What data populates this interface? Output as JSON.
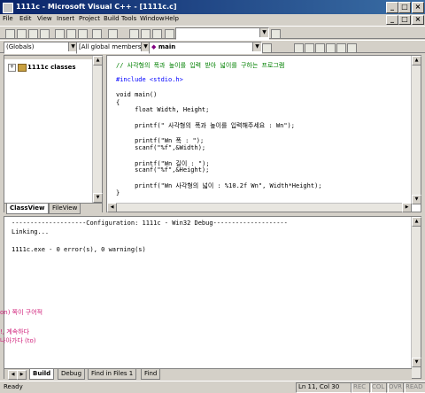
{
  "window": {
    "title": "1111c - Microsoft Visual C++ - [1111c.c]"
  },
  "menu": [
    "File",
    "Edit",
    "View",
    "Insert",
    "Project",
    "Build",
    "Tools",
    "Window",
    "Help"
  ],
  "toolbar2": {
    "scope_combo": "(Globals)",
    "members_combo": "[All global members]",
    "function_combo": "main"
  },
  "workspace": {
    "root_item": "1111c classes",
    "tabs": [
      "ClassView",
      "FileView"
    ]
  },
  "editor": {
    "lines": [
      {
        "text": "// 사각형의 폭과 높이를 입력 받아 넓이를 구하는 프로그램",
        "cls": "cmt"
      },
      {
        "text": "",
        "cls": ""
      },
      {
        "text": "#include <stdio.h>",
        "cls": "kw"
      },
      {
        "text": "",
        "cls": ""
      },
      {
        "text": "void main()",
        "cls": ""
      },
      {
        "text": "{",
        "cls": ""
      },
      {
        "text": "     float Width, Height;",
        "cls": ""
      },
      {
        "text": "",
        "cls": ""
      },
      {
        "text": "     printf(\" 사각형의 폭과 높이를 입력해주세요 : Wn\");",
        "cls": ""
      },
      {
        "text": "",
        "cls": ""
      },
      {
        "text": "     printf(\"Wn 폭 : \");",
        "cls": ""
      },
      {
        "text": "     scanf(\"%f\",&Width);",
        "cls": ""
      },
      {
        "text": "",
        "cls": ""
      },
      {
        "text": "     printf(\"Wn 길이 : \");",
        "cls": ""
      },
      {
        "text": "     scanf(\"%f\",&Height);",
        "cls": ""
      },
      {
        "text": "",
        "cls": ""
      },
      {
        "text": "     printf(\"Wn 사각형의 넓이 : %10.2f Wn\", Width*Height);",
        "cls": ""
      },
      {
        "text": "}",
        "cls": ""
      }
    ]
  },
  "output": {
    "lines": [
      "--------------------Configuration: 1111c - Win32 Debug--------------------",
      "Linking...",
      "",
      "1111c.exe - 0 error(s), 0 warning(s)"
    ],
    "tabs": [
      "Build",
      "Debug",
      "Find in Files 1",
      "Find"
    ]
  },
  "overlay_notes": [
    "on) 쪽이 구어적",
    "!, 계속하다",
    "나아가다 (to)"
  ],
  "status": {
    "left": "Ready",
    "position": "Ln 11, Col 30",
    "indicators": [
      "REC",
      "COL",
      "OVR",
      "READ"
    ]
  },
  "colors": {
    "title_start": "#0a246a",
    "title_end": "#3a6ea5",
    "comment": "#008000",
    "keyword": "#0000ff",
    "overlay": "#d0207a"
  }
}
